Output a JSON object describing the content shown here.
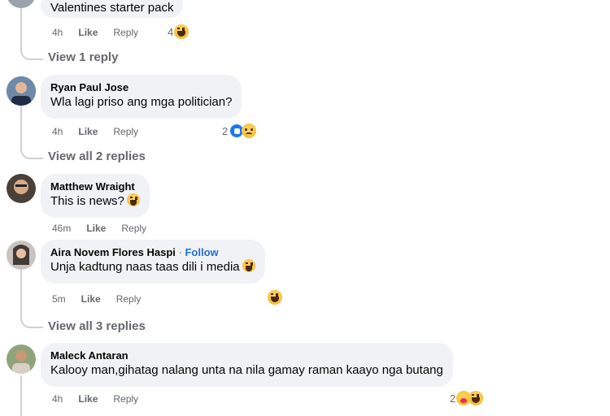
{
  "comments": [
    {
      "text": "Valentines starter pack",
      "time": "4h",
      "like": "Like",
      "reply": "Reply",
      "reaction_count": "4",
      "reactions": [
        "haha"
      ]
    },
    {
      "author": "Ryan Paul Jose",
      "text": "Wla lagi priso ang mga politician?",
      "time": "4h",
      "like": "Like",
      "reply": "Reply",
      "reaction_count": "2",
      "reactions": [
        "like",
        "sad"
      ]
    },
    {
      "author": "Matthew Wraight",
      "text": "This is news?",
      "time": "46m",
      "like": "Like",
      "reply": "Reply"
    },
    {
      "author": "Aira Novem Flores Haspi",
      "separator": "·",
      "follow": "Follow",
      "text": "Unja kadtung naas taas dili i media",
      "time": "5m",
      "like": "Like",
      "reply": "Reply",
      "reactions": [
        "haha"
      ]
    },
    {
      "author": "Maleck Antaran",
      "text": "Kalooy man,gihatag nalang unta na nila gamay raman kaayo nga butang",
      "time": "4h",
      "like": "Like",
      "reply": "Reply",
      "reaction_count": "2",
      "reactions": [
        "care",
        "haha"
      ]
    }
  ],
  "view_replies": [
    "View 1 reply",
    "View all 2 replies",
    "View all 3 replies"
  ],
  "colors": {
    "bubble": "#f0f2f5",
    "meta": "#65676b",
    "follow": "#216fdb",
    "like_blue": "#1877f2"
  }
}
